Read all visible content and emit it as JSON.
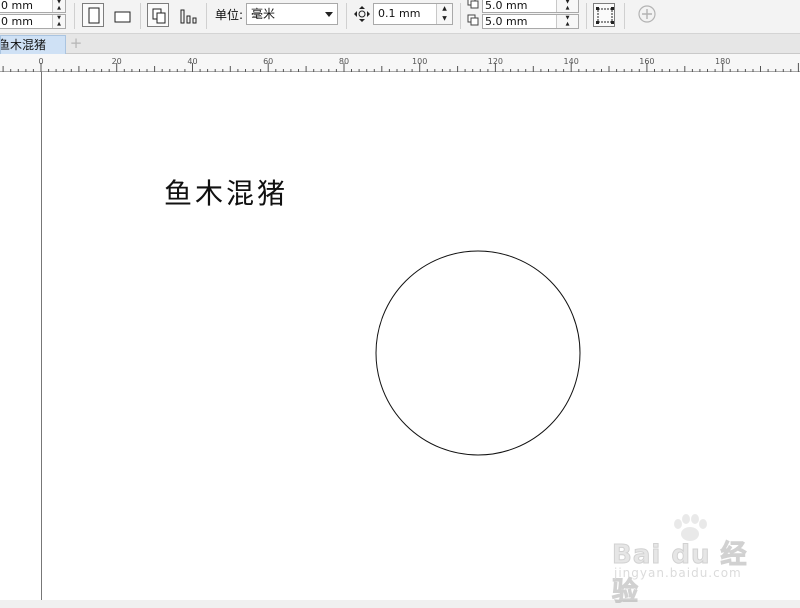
{
  "toolbar": {
    "page_width": "0 mm",
    "page_height": "0 mm",
    "units_label": "单位:",
    "units_value": "毫米",
    "nudge_value": "0.1 mm",
    "duplicate_x": "5.0 mm",
    "duplicate_y": "5.0 mm"
  },
  "tabs": {
    "document_tab": "鱼木混猪",
    "add_tab": "+"
  },
  "ruler": {
    "unit": "mm",
    "labels": [
      "0",
      "20",
      "40",
      "60",
      "80",
      "100",
      "120",
      "140",
      "160",
      "180"
    ]
  },
  "canvas": {
    "text": "鱼木混猪"
  },
  "watermark": {
    "logo": "Bai du 经验",
    "url": "jingyan.baidu.com"
  },
  "icons": {
    "portrait": "portrait-icon",
    "landscape": "landscape-icon",
    "all_pages": "all-pages-icon",
    "current_page": "current-page-icon",
    "nudge": "nudge-icon",
    "duplicate_x": "duplicate-x-icon",
    "duplicate_y": "duplicate-y-icon",
    "page_frame": "page-frame-icon",
    "add": "add-circle-icon"
  }
}
